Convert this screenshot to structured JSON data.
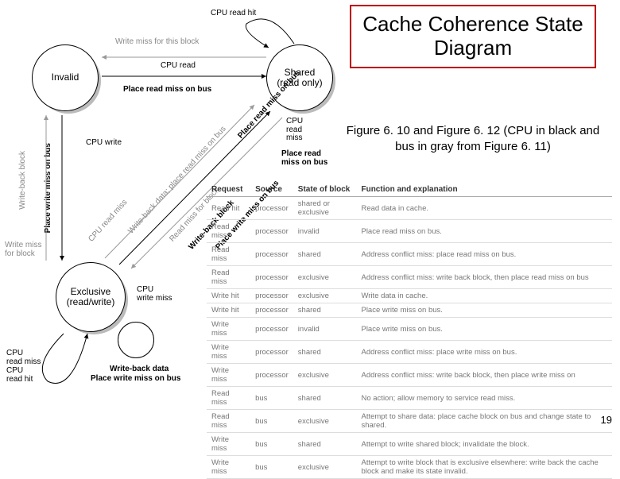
{
  "title": "Cache Coherence State Diagram",
  "caption": "Figure 6. 10 and Figure 6. 12 (CPU in black and bus in gray from Figure 6. 11)",
  "page_number": "19",
  "states": {
    "invalid": "Invalid",
    "shared": "Shared\n(read only)",
    "exclusive": "Exclusive\n(read/write)"
  },
  "transitions": {
    "cpu_read_hit": "CPU read hit",
    "write_miss_block": "Write miss for this block",
    "cpu_read": "CPU read",
    "place_read_miss": "Place read miss on bus",
    "cpu_write": "CPU write",
    "cpu_read_miss": "CPU read miss",
    "cpu_read_hit2": "CPU read hit",
    "write_back_block": "Write-back block",
    "place_write_miss": "Place write miss on bus",
    "write_miss_for_block": "Write miss\nfor block",
    "cpu_write_miss": "CPU\nwrite miss",
    "write_back_data": "Write-back data",
    "read_miss_label": "Read miss",
    "cpu_read_miss_label": "CPU\nread\nmiss"
  },
  "table": {
    "headers": [
      "Request",
      "Source",
      "State of block",
      "Function and explanation"
    ],
    "rows": [
      [
        "Read hit",
        "processor",
        "shared or exclusive",
        "Read data in cache."
      ],
      [
        "Read miss",
        "processor",
        "invalid",
        "Place read miss on bus."
      ],
      [
        "Read miss",
        "processor",
        "shared",
        "Address conflict miss: place read miss on bus."
      ],
      [
        "Read miss",
        "processor",
        "exclusive",
        "Address conflict miss: write back block, then place read miss on bus"
      ],
      [
        "Write hit",
        "processor",
        "exclusive",
        "Write data in cache."
      ],
      [
        "Write hit",
        "processor",
        "shared",
        "Place write miss on bus."
      ],
      [
        "Write miss",
        "processor",
        "invalid",
        "Place write miss on bus."
      ],
      [
        "Write miss",
        "processor",
        "shared",
        "Address conflict miss: place write miss on bus."
      ],
      [
        "Write miss",
        "processor",
        "exclusive",
        "Address conflict miss: write back block, then place write miss on"
      ],
      [
        "Read miss",
        "bus",
        "shared",
        "No action; allow memory to service read miss."
      ],
      [
        "Read miss",
        "bus",
        "exclusive",
        "Attempt to share data: place cache block on bus and change state to shared."
      ],
      [
        "Write miss",
        "bus",
        "shared",
        "Attempt to write shared block; invalidate the block."
      ],
      [
        "Write miss",
        "bus",
        "exclusive",
        "Attempt to write block that is exclusive elsewhere: write back the cache block and make its state invalid."
      ]
    ]
  }
}
